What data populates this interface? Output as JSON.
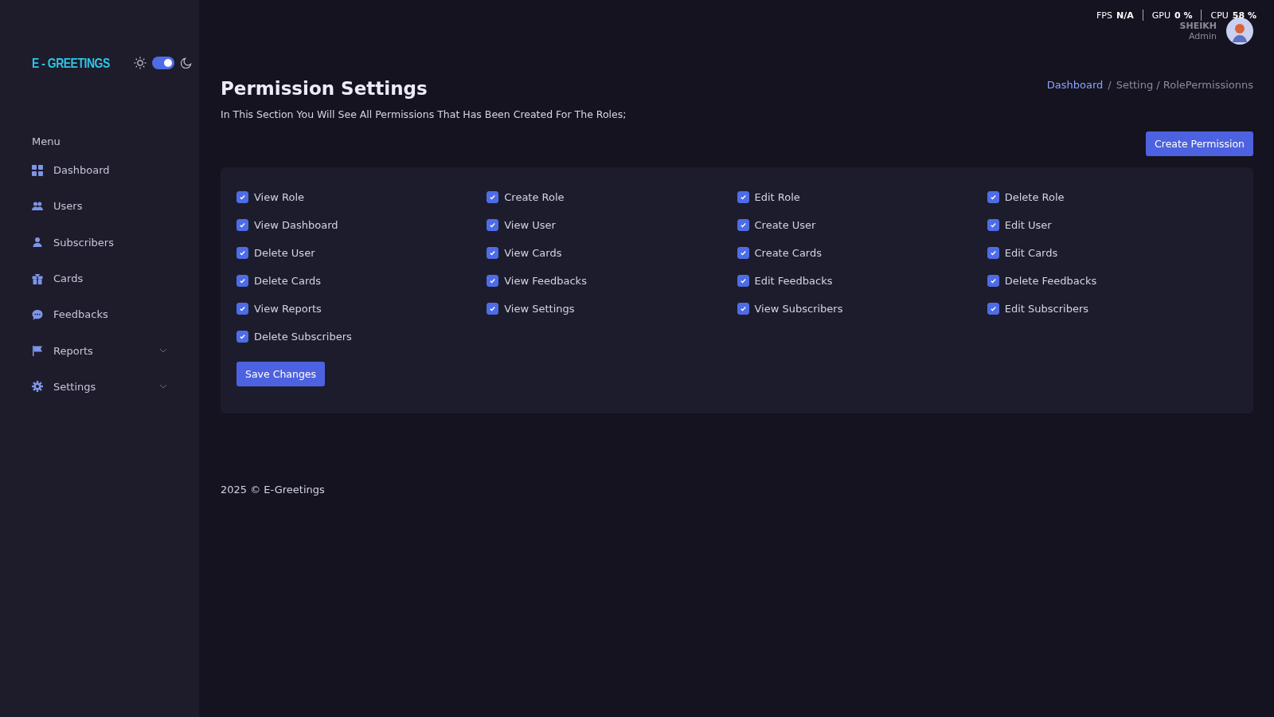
{
  "brand": {
    "logo": "E - GREETINGS",
    "dark_mode": true
  },
  "stats": [
    {
      "label": "FPS",
      "value": "N/A"
    },
    {
      "label": "GPU",
      "value": "0 %"
    },
    {
      "label": "CPU",
      "value": "58 %"
    }
  ],
  "user": {
    "name": "SHEIKH",
    "role": "Admin"
  },
  "sidebar": {
    "heading": "Menu",
    "items": [
      {
        "label": "Dashboard",
        "kind": "grid",
        "has_submenu": false
      },
      {
        "label": "Users",
        "kind": "users",
        "has_submenu": false
      },
      {
        "label": "Subscribers",
        "kind": "user",
        "has_submenu": false
      },
      {
        "label": "Cards",
        "kind": "gift",
        "has_submenu": false
      },
      {
        "label": "Feedbacks",
        "kind": "chat",
        "has_submenu": false
      },
      {
        "label": "Reports",
        "kind": "flag",
        "has_submenu": true
      },
      {
        "label": "Settings",
        "kind": "gear",
        "has_submenu": true
      }
    ]
  },
  "page": {
    "title": "Permission Settings",
    "description": "In This Section You Will See All Permissions That Has Been Created For The Roles;",
    "breadcrumb": [
      "Dashboard",
      "/",
      "Setting / RolePermissionns"
    ],
    "create_button": "Create Permission"
  },
  "permissions": [
    {
      "label": "View Role",
      "checked": true
    },
    {
      "label": "Create Role",
      "checked": true
    },
    {
      "label": "Edit Role",
      "checked": true
    },
    {
      "label": "Delete Role",
      "checked": true
    },
    {
      "label": "View Dashboard",
      "checked": true
    },
    {
      "label": "View User",
      "checked": true
    },
    {
      "label": "Create User",
      "checked": true
    },
    {
      "label": "Edit User",
      "checked": true
    },
    {
      "label": "Delete User",
      "checked": true
    },
    {
      "label": "View Cards",
      "checked": true
    },
    {
      "label": "Create Cards",
      "checked": true
    },
    {
      "label": "Edit Cards",
      "checked": true
    },
    {
      "label": "Delete Cards",
      "checked": true
    },
    {
      "label": "View Feedbacks",
      "checked": true
    },
    {
      "label": "Edit Feedbacks",
      "checked": true
    },
    {
      "label": "Delete Feedbacks",
      "checked": true
    },
    {
      "label": "View Reports",
      "checked": true
    },
    {
      "label": "View Settings",
      "checked": true
    },
    {
      "label": "View Subscribers",
      "checked": true
    },
    {
      "label": "Edit Subscribers",
      "checked": true
    },
    {
      "label": "Delete Subscribers",
      "checked": true
    }
  ],
  "save_button": "Save Changes",
  "footer": "2025 © E-Greetings"
}
